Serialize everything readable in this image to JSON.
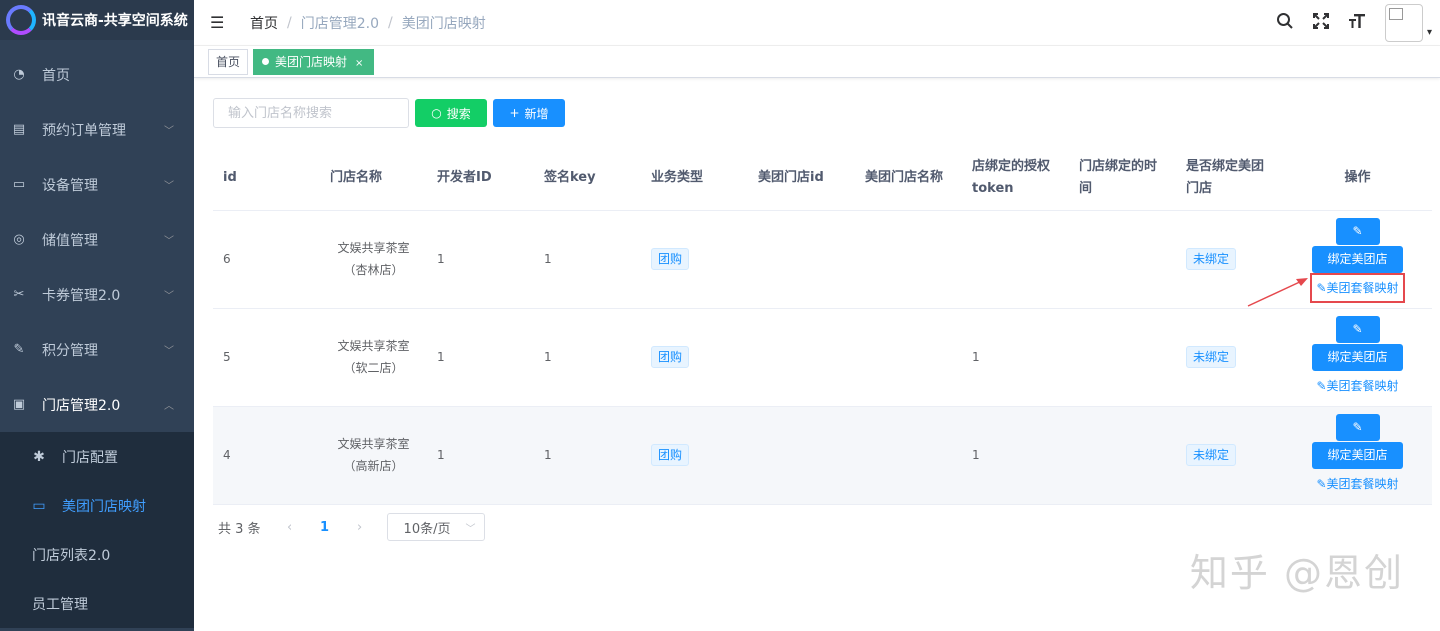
{
  "app": {
    "title": "讯音云商-共享空间系统"
  },
  "sidebar": {
    "items": [
      {
        "label": "首页",
        "icon": "dashboard-icon",
        "glyph": "◔"
      },
      {
        "label": "预约订单管理",
        "icon": "document-icon",
        "glyph": "▤"
      },
      {
        "label": "设备管理",
        "icon": "calendar-icon",
        "glyph": "▭"
      },
      {
        "label": "储值管理",
        "icon": "money-icon",
        "glyph": "◎"
      },
      {
        "label": "卡券管理2.0",
        "icon": "coupon-icon",
        "glyph": "✂"
      },
      {
        "label": "积分管理",
        "icon": "edit-icon",
        "glyph": "✎"
      },
      {
        "label": "门店管理2.0",
        "icon": "shop-icon",
        "glyph": "▣"
      }
    ],
    "submenu": [
      {
        "label": "门店配置",
        "icon": "gear-icon",
        "glyph": "✱"
      },
      {
        "label": "美团门店映射",
        "icon": "calendar-icon",
        "glyph": "▭"
      },
      {
        "label": "门店列表2.0"
      },
      {
        "label": "员工管理"
      }
    ]
  },
  "header": {
    "breadcrumb": [
      "首页",
      "门店管理2.0",
      "美团门店映射"
    ]
  },
  "tags": {
    "home": "首页",
    "active": "美团门店映射",
    "close": "×"
  },
  "toolbar": {
    "search_placeholder": "输入门店名称搜索",
    "search_label": "搜索",
    "add_label": "新增"
  },
  "table": {
    "columns": [
      "id",
      "门店名称",
      "开发者ID",
      "签名key",
      "业务类型",
      "美团门店id",
      "美团门店名称",
      "店绑定的授权token",
      "门店绑定的时间",
      "是否绑定美团门店",
      "操作"
    ],
    "rows": [
      {
        "id": "6",
        "name_line1": "文娱共享茶室",
        "name_line2": "（杏林店）",
        "developer_id": "1",
        "sign_key": "1",
        "business_type": "团购",
        "meituan_id": "",
        "meituan_name": "",
        "token": "",
        "bind_time": "",
        "bound": "未绑定"
      },
      {
        "id": "5",
        "name_line1": "文娱共享茶室",
        "name_line2": "（软二店）",
        "developer_id": "1",
        "sign_key": "1",
        "business_type": "团购",
        "meituan_id": "",
        "meituan_name": "",
        "token": "1",
        "bind_time": "",
        "bound": "未绑定"
      },
      {
        "id": "4",
        "name_line1": "文娱共享茶室",
        "name_line2": "（高新店）",
        "developer_id": "1",
        "sign_key": "1",
        "business_type": "团购",
        "meituan_id": "",
        "meituan_name": "",
        "token": "1",
        "bind_time": "",
        "bound": "未绑定"
      }
    ],
    "ops": {
      "bind_label": "绑定美团店",
      "mapping_label": "美团套餐映射"
    }
  },
  "pagination": {
    "total": "共 3 条",
    "page": "1",
    "page_size": "10条/页"
  },
  "watermark": "知乎 @恩创",
  "colors": {
    "sidebar": "#304156",
    "primary": "#1890ff",
    "success": "#13ce66",
    "tag_active": "#42b983",
    "highlight": "#e5484d"
  }
}
